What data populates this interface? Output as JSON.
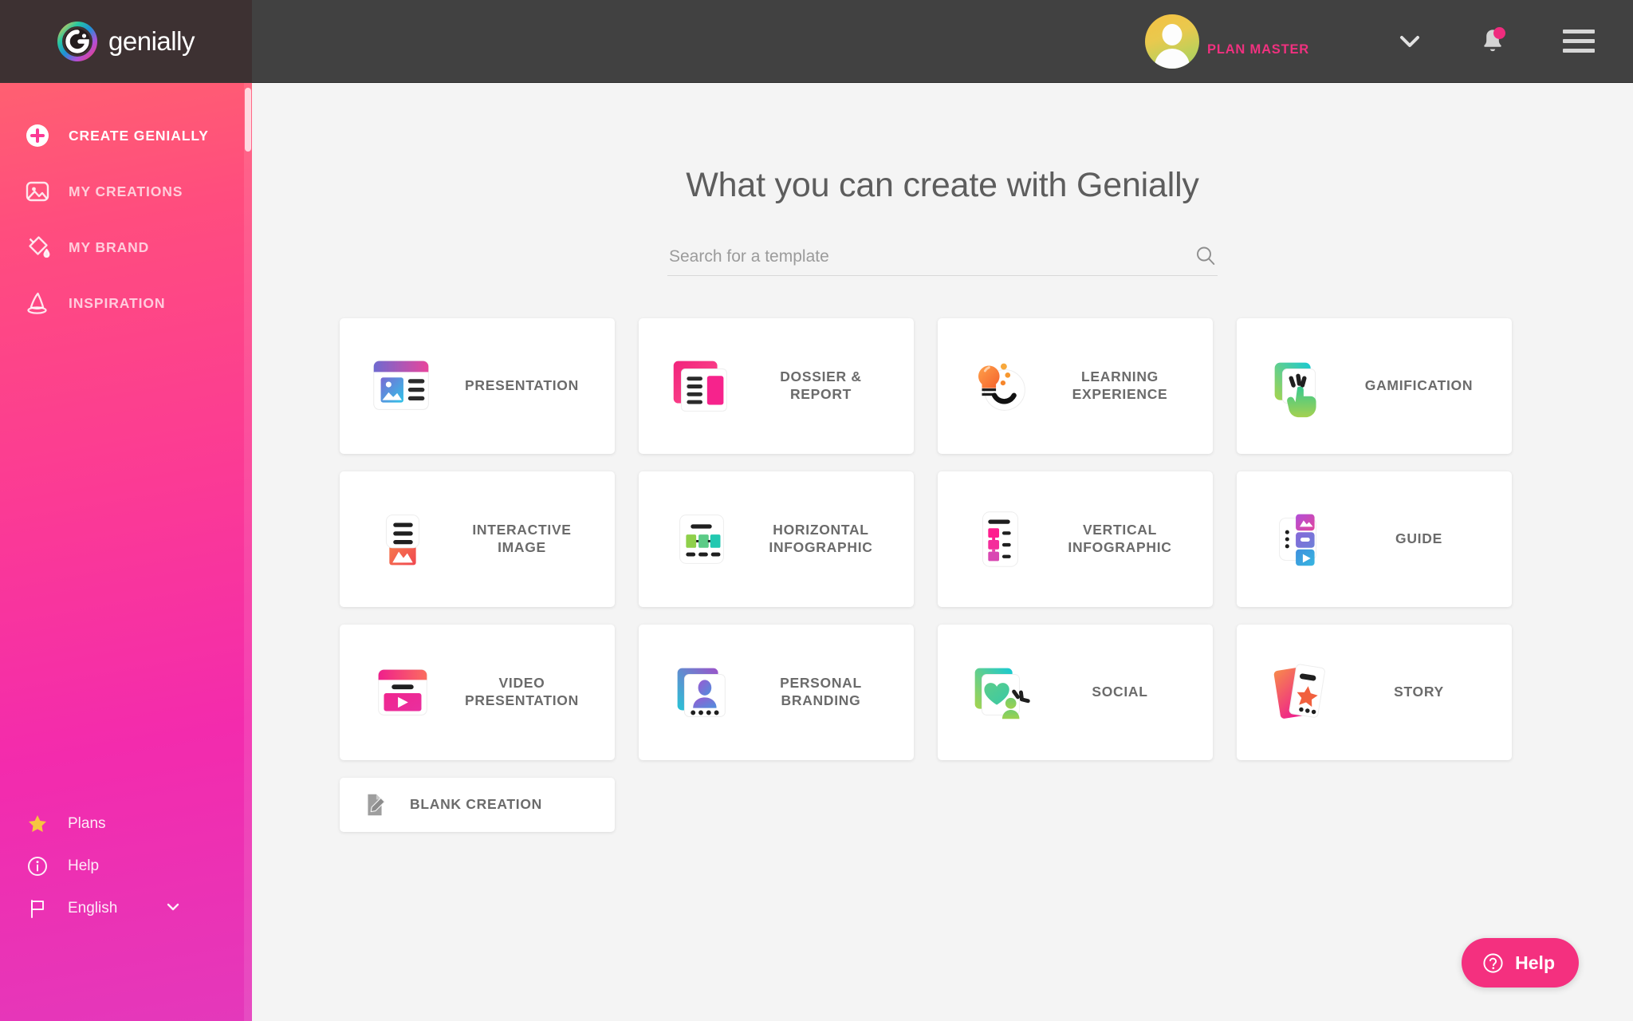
{
  "brand": {
    "logo_text": "genially",
    "logo_icon": "genially-logo-icon"
  },
  "header": {
    "plan_label": "PLAN MASTER",
    "avatar_icon": "user-avatar-icon",
    "caret_icon": "chevron-down-icon",
    "bell_icon": "notification-bell-icon",
    "menu_icon": "hamburger-menu-icon",
    "accent_pink": "#f0317f",
    "background": "#414141"
  },
  "sidebar": {
    "background_gradient": [
      "#ff6a6a",
      "#e438bb"
    ],
    "items": [
      {
        "label": "CREATE GENIALLY",
        "icon": "plus-circle-icon",
        "active": true
      },
      {
        "label": "MY CREATIONS",
        "icon": "image-icon",
        "active": false
      },
      {
        "label": "MY BRAND",
        "icon": "paint-bucket-icon",
        "active": false
      },
      {
        "label": "INSPIRATION",
        "icon": "wizard-hat-icon",
        "active": false
      }
    ],
    "bottom_items": [
      {
        "label": "Plans",
        "icon": "star-icon"
      },
      {
        "label": "Help",
        "icon": "info-circle-icon"
      },
      {
        "label": "English",
        "icon": "flag-icon",
        "caret": "chevron-down-icon"
      }
    ]
  },
  "main": {
    "title": "What you can create with Genially",
    "search": {
      "placeholder": "Search for a template",
      "value": "",
      "icon": "search-icon"
    },
    "cards": [
      {
        "label": "PRESENTATION",
        "icon": "presentation-icon"
      },
      {
        "label": "DOSSIER &\n REPORT",
        "icon": "dossier-report-icon"
      },
      {
        "label": "LEARNING\n EXPERIENCE",
        "icon": "learning-experience-icon"
      },
      {
        "label": "GAMIFICATION",
        "icon": "gamification-icon"
      },
      {
        "label": "INTERACTIVE\n IMAGE",
        "icon": "interactive-image-icon"
      },
      {
        "label": "HORIZONTAL\n INFOGRAPHIC",
        "icon": "horizontal-infographic-icon"
      },
      {
        "label": "VERTICAL\n INFOGRAPHIC",
        "icon": "vertical-infographic-icon"
      },
      {
        "label": "GUIDE",
        "icon": "guide-icon"
      },
      {
        "label": "VIDEO\n PRESENTATION",
        "icon": "video-presentation-icon"
      },
      {
        "label": "PERSONAL\n BRANDING",
        "icon": "personal-branding-icon"
      },
      {
        "label": "SOCIAL",
        "icon": "social-icon"
      },
      {
        "label": "STORY",
        "icon": "story-icon"
      }
    ],
    "blank_card": {
      "label": "BLANK CREATION",
      "icon": "pencil-document-icon"
    }
  },
  "help_fab": {
    "label": "Help",
    "icon": "question-circle-icon",
    "color": "#f4307f"
  }
}
